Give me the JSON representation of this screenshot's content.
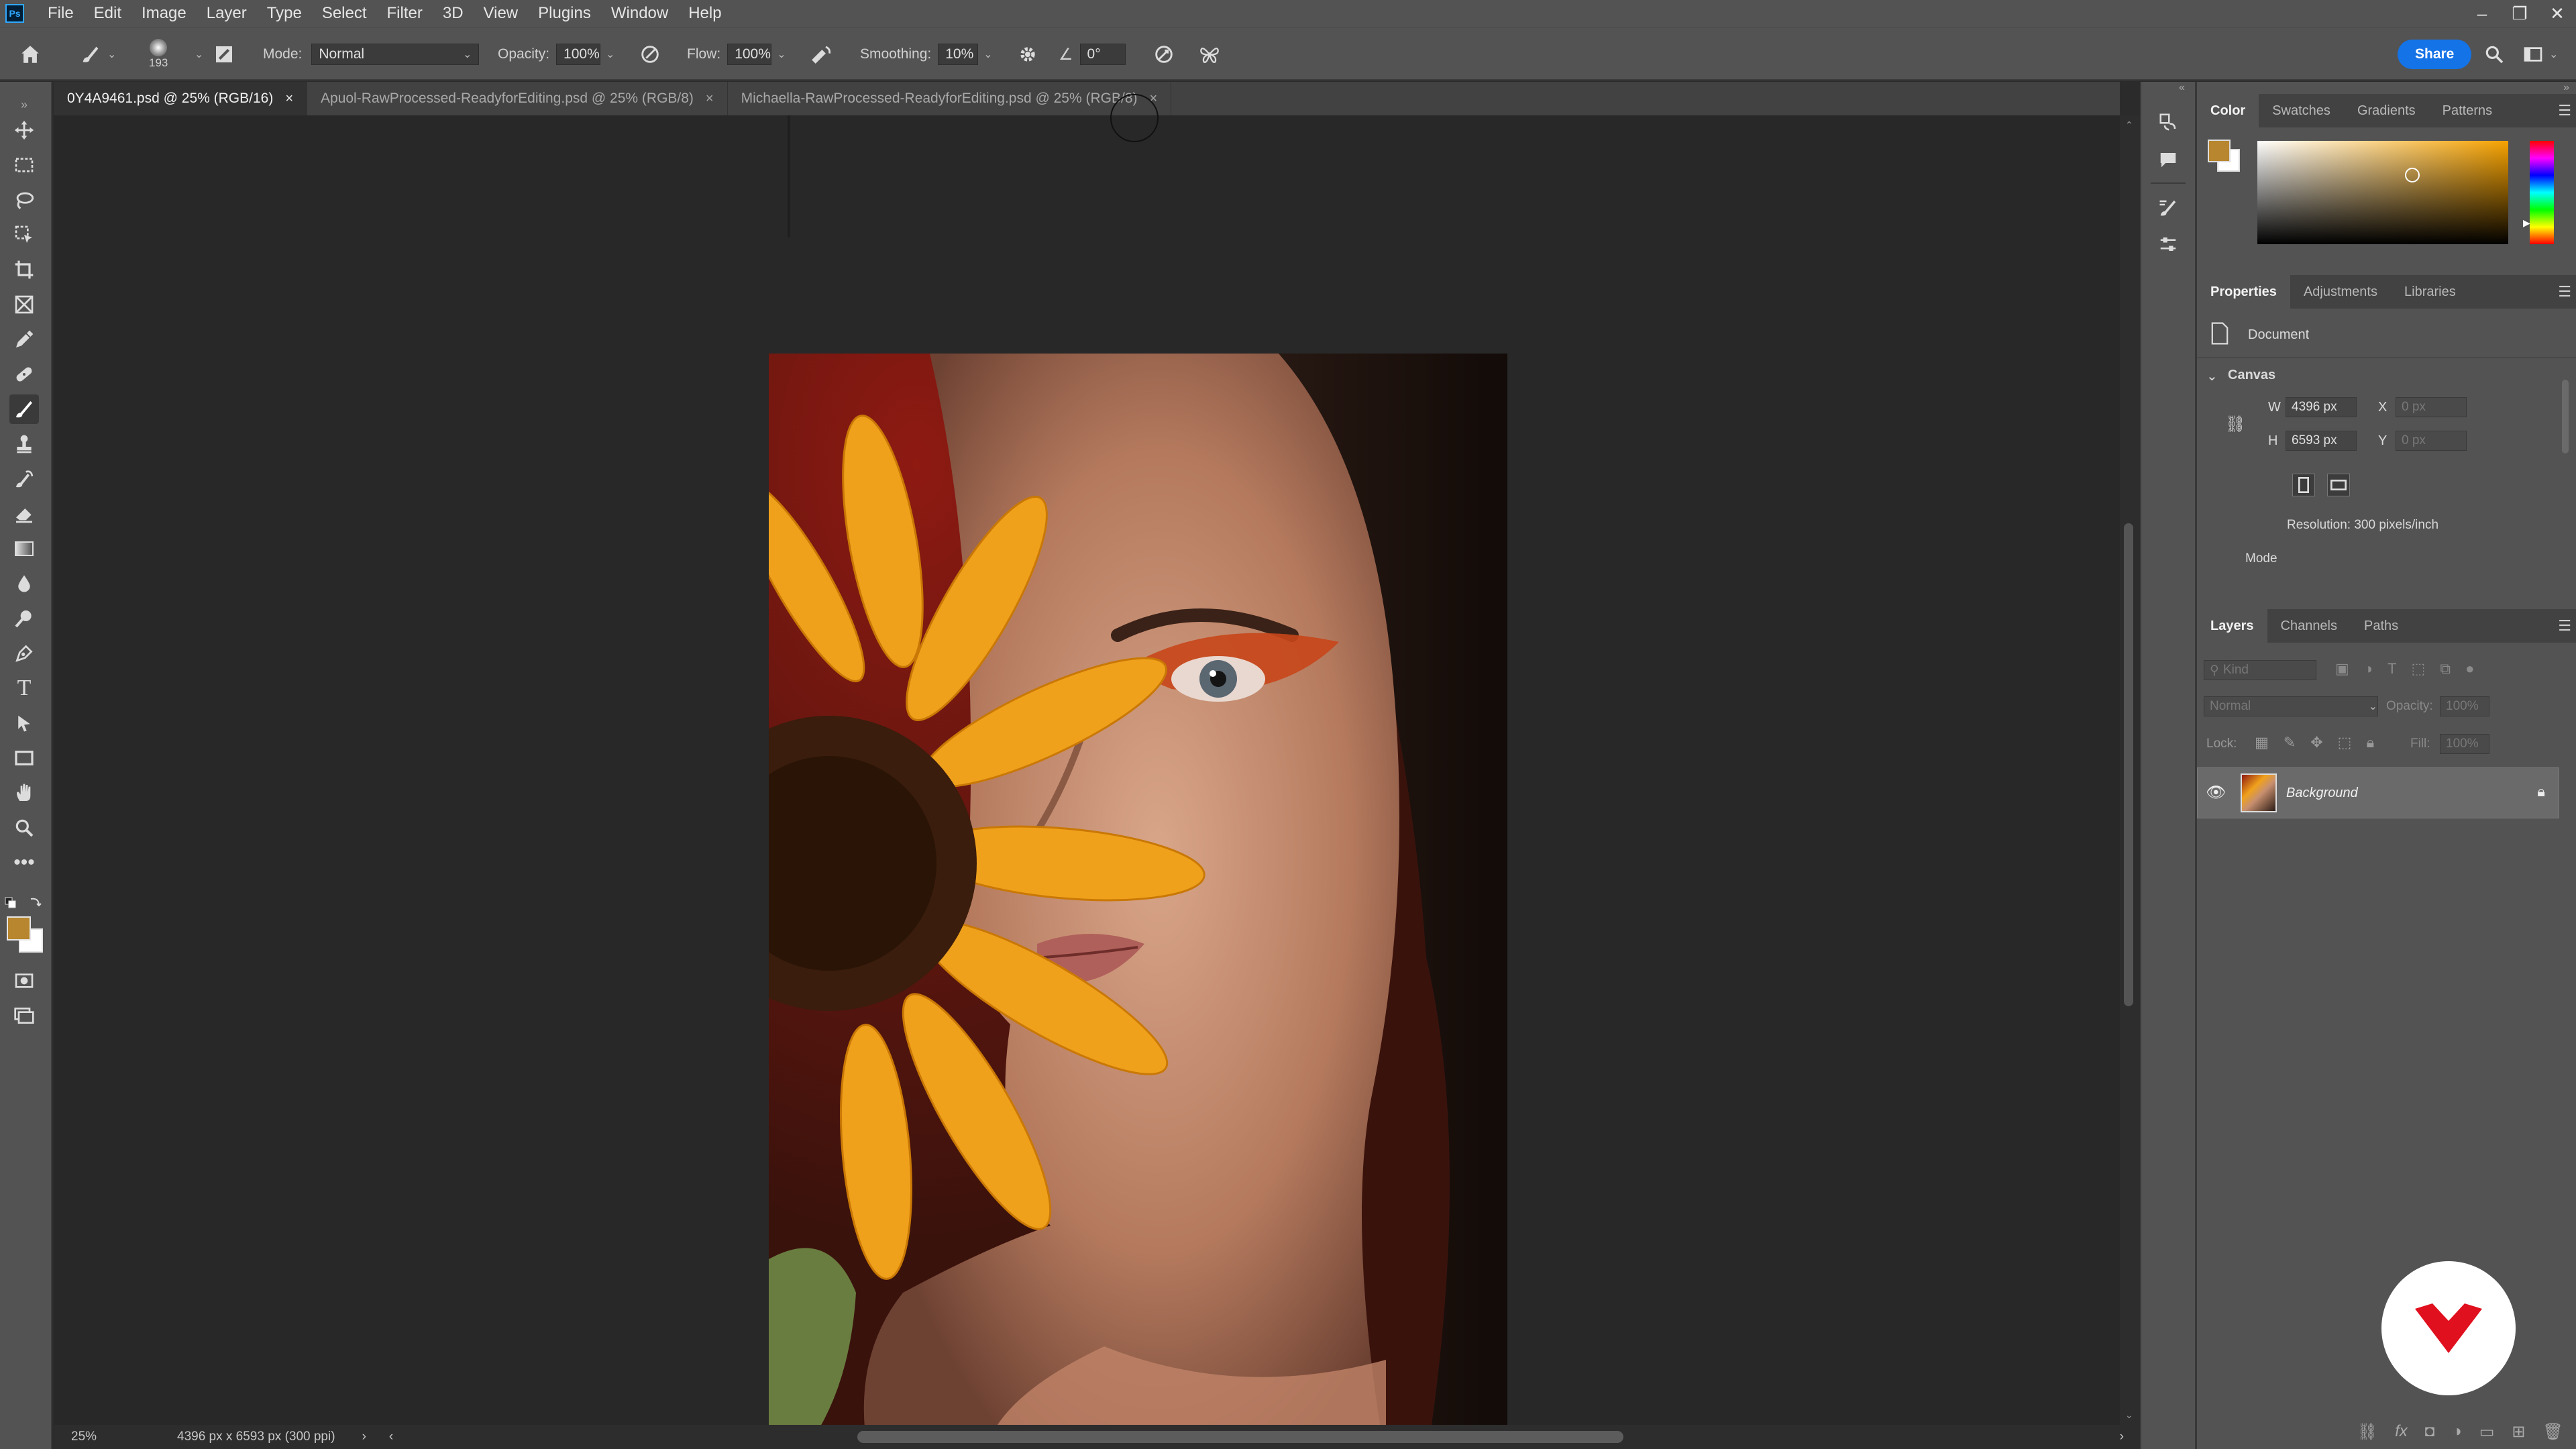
{
  "app": {
    "logo_text": "Ps"
  },
  "menu": [
    "File",
    "Edit",
    "Image",
    "Layer",
    "Type",
    "Select",
    "Filter",
    "3D",
    "View",
    "Plugins",
    "Window",
    "Help"
  ],
  "options": {
    "brush_size": "193",
    "mode_label": "Mode:",
    "mode_value": "Normal",
    "opacity_label": "Opacity:",
    "opacity_value": "100%",
    "flow_label": "Flow:",
    "flow_value": "100%",
    "smoothing_label": "Smoothing:",
    "smoothing_value": "10%",
    "angle_value": "0°",
    "share_label": "Share"
  },
  "tabs": [
    {
      "label": "0Y4A9461.psd @ 25% (RGB/16)",
      "active": true
    },
    {
      "label": "Apuol-RawProcessed-ReadyforEditing.psd @ 25% (RGB/8)",
      "active": false
    },
    {
      "label": "Michaella-RawProcessed-ReadyforEditing.psd @ 25% (RGB/8)",
      "active": false
    }
  ],
  "status": {
    "zoom": "25%",
    "doc_info": "4396 px x 6593 px (300 ppi)"
  },
  "color_panel": {
    "tabs": [
      "Color",
      "Swatches",
      "Gradients",
      "Patterns"
    ],
    "foreground": "#b8862e",
    "background": "#ffffff"
  },
  "properties_panel": {
    "tabs": [
      "Properties",
      "Adjustments",
      "Libraries"
    ],
    "doc_label": "Document",
    "section": "Canvas",
    "w_label": "W",
    "w_value": "4396 px",
    "h_label": "H",
    "h_value": "6593 px",
    "x_label": "X",
    "x_placeholder": "0 px",
    "y_label": "Y",
    "y_placeholder": "0 px",
    "resolution": "Resolution: 300 pixels/inch",
    "mode_label": "Mode"
  },
  "layers_panel": {
    "tabs": [
      "Layers",
      "Channels",
      "Paths"
    ],
    "kind_placeholder": "Kind",
    "blend_mode": "Normal",
    "opacity_label": "Opacity:",
    "opacity_value": "100%",
    "lock_label": "Lock:",
    "fill_label": "Fill:",
    "fill_value": "100%",
    "layers": [
      {
        "name": "Background",
        "visible": true,
        "locked": true
      }
    ]
  }
}
